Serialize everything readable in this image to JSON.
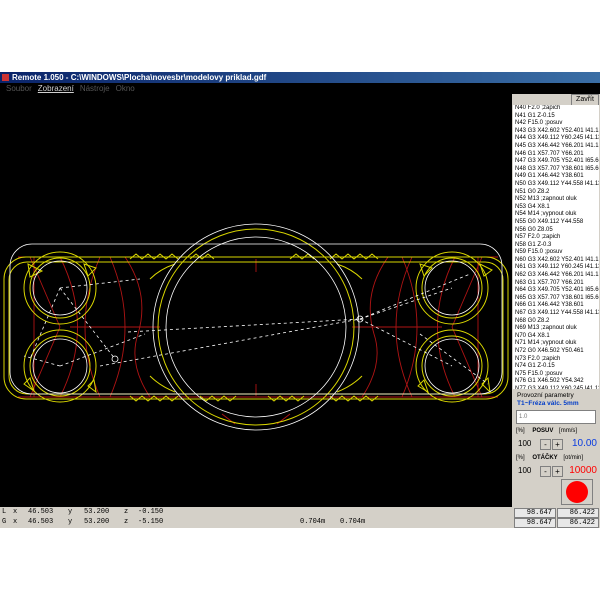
{
  "window": {
    "title": "Remote 1.050 - C:\\WINDOWS\\Plocha\\novesbr\\modelovy priklad.gdf",
    "close_label": "Zavřít"
  },
  "menu": {
    "items": [
      "Soubor",
      "Zobrazení",
      "Nástroje",
      "Okno"
    ]
  },
  "code_list": [
    "N40 F2.0 ;zapich",
    "N41 G1 Z-0.15",
    "N42 F15.0 ;posuv",
    "N43 G3 X42.602 Y52.401 I41.132",
    "N44 G3 X49.112 Y60.245 I41.132",
    "N45 G3 X46.442 Y66.201 I41.132",
    "N46 G1 X57.707 Y66.201",
    "N47 G3 X49.705 Y52.401 I65.605",
    "N48 G3 X57.707 Y38.601 I65.605",
    "N49 G1 X46.442 Y38.601",
    "N50 G3 X49.112 Y44.558 I41.132",
    "N51 G0 Z8.2",
    "N52 M13 ;zapnout oluk",
    "N53 G4 X8.1",
    "N54 M14 ;vypnout oluk",
    "N55 G0 X49.112 Y44.558",
    "N56 G0 Z8.05",
    "N57 F2.0 ;zapich",
    "N58 G1 Z-0.3",
    "N59 F15.0 ;posuv",
    "N60 G3 X42.602 Y52.401 I41.132",
    "N61 G3 X49.112 Y60.245 I41.132",
    "N62 G3 X46.442 Y66.201 I41.132",
    "N63 G1 X57.707 Y66.201",
    "N64 G3 X49.705 Y52.401 I65.605",
    "N65 G3 X57.707 Y38.601 I65.605",
    "N66 G1 X46.442 Y38.601",
    "N67 G3 X49.112 Y44.558 I41.132",
    "N68 G0 Z8.2",
    "N69 M13 ;zapnout oluk",
    "N70 G4 X8.1",
    "N71 M14 ;vypnout oluk",
    "N72 G0 X46.502 Y50.461",
    "N73 F2.0 ;zapich",
    "N74 G1 Z-0.15",
    "N75 F15.0 ;posuv",
    "N76 G1 X46.502 Y54.342",
    "N77 G3 X49.112 Y60.245 I41.132",
    "N78 G3 X46.502 Y56.148 I41.132",
    "N79 G1 X46.502 Y60.201",
    "N80 G1 X51.402 Y66.201"
  ],
  "active_line_index": 40,
  "params": {
    "title": "Provozní parametry",
    "tool": "T1~Fréza válc. 5mm",
    "input_placeholder": "1.0",
    "feed": {
      "unit_percent": "[%]",
      "label": "POSUV",
      "unit": "[mm/s]",
      "percent": "100",
      "minus": "-",
      "plus": "+",
      "value": "10.00"
    },
    "speed": {
      "unit_percent": "[%]",
      "label": "OTÁČKY",
      "unit": "[ot/min]",
      "percent": "100",
      "minus": "-",
      "plus": "+",
      "value": "10000"
    }
  },
  "status": {
    "row1": {
      "prefix": "L",
      "x_label": "x",
      "x": "46.503",
      "y_label": "y",
      "y": "53.200",
      "z_label": "z",
      "z": "-0.150",
      "r1": "98.647",
      "r2": "86.422"
    },
    "row2": {
      "prefix": "G",
      "x_label": "x",
      "x": "46.503",
      "y_label": "y",
      "y": "53.200",
      "z_label": "z",
      "z": "-5.150",
      "m1": "0.704m",
      "m2": "0.704m",
      "r1": "98.647",
      "r2": "86.422"
    }
  },
  "colors": {
    "toolpath": "#d9d600",
    "rapid": "#ffffff",
    "contour": "#b01414",
    "background": "#000000",
    "accent_blue": "#0a3ce0",
    "stop_red": "#ff0000"
  }
}
